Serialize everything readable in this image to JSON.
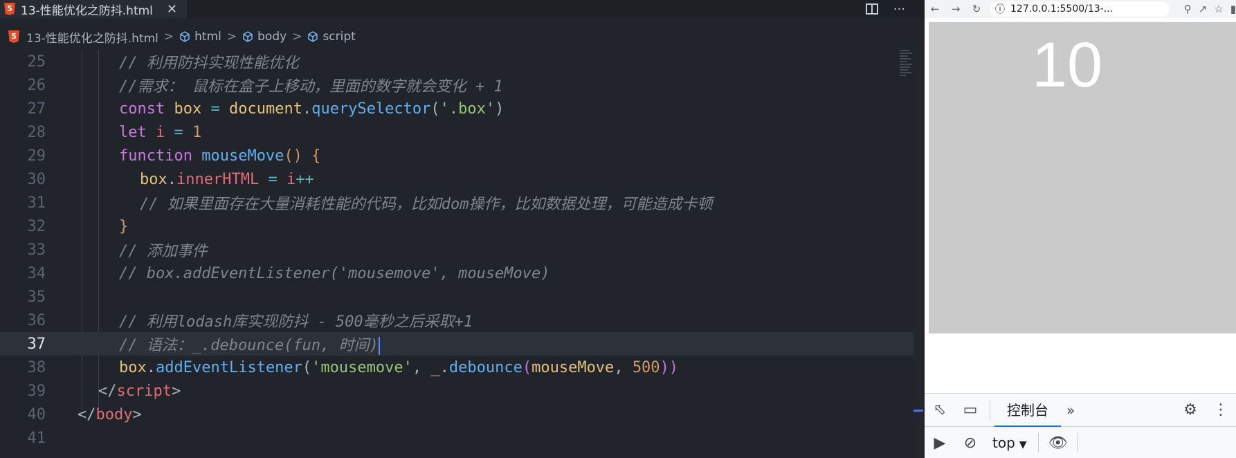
{
  "editor": {
    "tab_title": "13-性能优化之防抖.html",
    "tab_close": "✕",
    "tab_badge": "5",
    "actions_more": "···",
    "breadcrumb": {
      "file": "13-性能优化之防抖.html",
      "sep": ">",
      "html": "html",
      "body": "body",
      "script": "script"
    },
    "lines": [
      {
        "n": "25"
      },
      {
        "n": "26"
      },
      {
        "n": "27"
      },
      {
        "n": "28"
      },
      {
        "n": "29"
      },
      {
        "n": "30"
      },
      {
        "n": "31"
      },
      {
        "n": "32"
      },
      {
        "n": "33"
      },
      {
        "n": "34"
      },
      {
        "n": "35"
      },
      {
        "n": "36"
      },
      {
        "n": "37"
      },
      {
        "n": "38"
      },
      {
        "n": "39"
      },
      {
        "n": "40"
      },
      {
        "n": "41"
      }
    ],
    "code": {
      "l25": "// 利用防抖实现性能优化",
      "l26": "//需求： 鼠标在盒子上移动，里面的数字就会变化 + 1",
      "l27_const": "const",
      "l27_box": "box",
      "l27_eq": " = ",
      "l27_doc": "document",
      "l27_dot": ".",
      "l27_qs": "querySelector",
      "l27_open": "(",
      "l27_str": "'.box'",
      "l27_close": ")",
      "l28_let": "let",
      "l28_i": "i",
      "l28_eq": " = ",
      "l28_num": "1",
      "l29_fn": "function",
      "l29_name": "mouseMove",
      "l29_rest": "() {",
      "l30_box": "box",
      "l30_dot": ".",
      "l30_prop": "innerHTML",
      "l30_eq": " = ",
      "l30_i": "i",
      "l30_op": "++",
      "l31": "// 如果里面存在大量消耗性能的代码，比如dom操作，比如数据处理，可能造成卡顿",
      "l32": "}",
      "l33": "// 添加事件",
      "l34": "// box.addEventListener('mousemove', mouseMove)",
      "l36": "// 利用lodash库实现防抖 - 500毫秒之后采取+1",
      "l37": "// 语法：_.debounce(fun, 时间)",
      "l38_box": "box",
      "l38_dot": ".",
      "l38_fn": "addEventListener",
      "l38_open": "(",
      "l38_str": "'mousemove'",
      "l38_comma": ", ",
      "l38_us": "_",
      "l38_dot2": ".",
      "l38_deb": "debounce",
      "l38_open2": "(",
      "l38_arg": "mouseMove",
      "l38_comma2": ", ",
      "l38_num": "500",
      "l38_close": "))",
      "l39_open": "</",
      "l39_tag": "script",
      "l39_close": ">",
      "l40_open": "</",
      "l40_tag": "body",
      "l40_close": ">"
    }
  },
  "browser": {
    "nav_back": "←",
    "nav_forward": "→",
    "reload": "↻",
    "url": "127.0.0.1:5500/13-...",
    "info_icon": "ⓘ",
    "box_value": "10"
  },
  "devtools": {
    "console_tab": "控制台",
    "more_tabs": "»",
    "context": "top",
    "context_caret": "▼"
  },
  "colors": {
    "editor_bg": "#21252b",
    "comment": "#7f848e",
    "keyword": "#c678dd",
    "string": "#98c379",
    "function": "#61afef",
    "variable": "#e5c07b",
    "number": "#d19a66",
    "box_bg": "#cacaca"
  }
}
